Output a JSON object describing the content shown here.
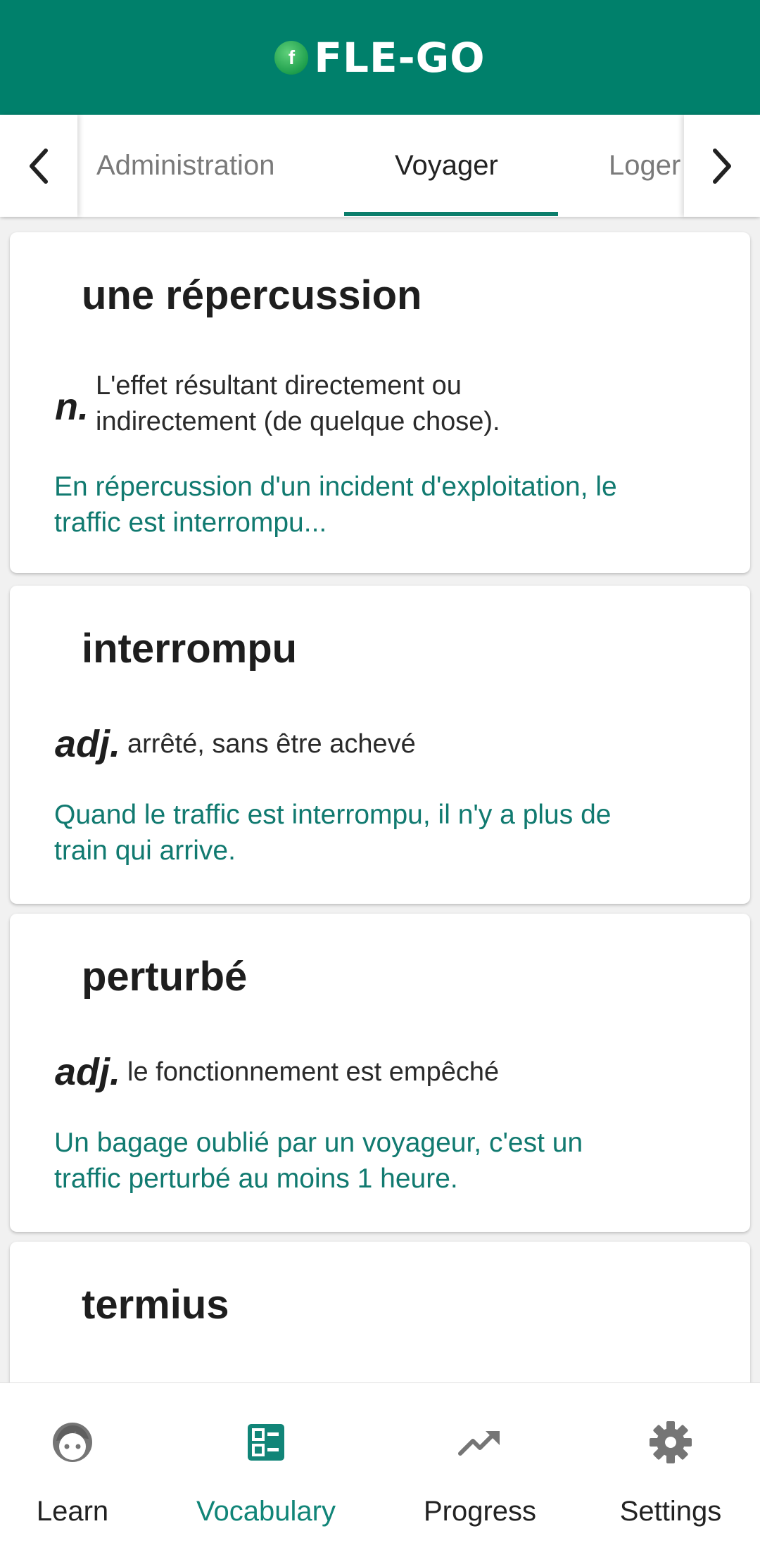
{
  "app": {
    "brand_letter": "f",
    "brand_name": "FLE-GO"
  },
  "tabs": [
    {
      "label": "Administration",
      "active": false
    },
    {
      "label": "Voyager",
      "active": true
    },
    {
      "label": "Loger",
      "active": false
    }
  ],
  "cards": [
    {
      "word": "une répercussion",
      "pos": "n.",
      "definition_lines": [
        "L'effet résultant directement ou",
        "indirectement (de quelque chose)."
      ],
      "example_lines": [
        "En répercussion d'un incident d'exploitation, le",
        "traffic est interrompu..."
      ]
    },
    {
      "word": "interrompu",
      "pos": "adj.",
      "definition_lines": [
        "arrêté, sans être achevé"
      ],
      "example_lines": [
        "Quand le traffic est interrompu, il n'y a plus de",
        "train qui arrive."
      ]
    },
    {
      "word": "perturbé",
      "pos": "adj.",
      "definition_lines": [
        "le fonctionnement est empêché"
      ],
      "example_lines": [
        "Un bagage oublié par un voyageur, c'est un",
        "traffic perturbé au moins 1 heure."
      ]
    },
    {
      "word": "termius"
    }
  ],
  "bottom_nav": [
    {
      "label": "Learn",
      "icon": "face-icon",
      "active": false
    },
    {
      "label": "Vocabulary",
      "icon": "vocabulary-list-icon",
      "active": true
    },
    {
      "label": "Progress",
      "icon": "trending-up-icon",
      "active": false
    },
    {
      "label": "Settings",
      "icon": "gear-icon",
      "active": false
    }
  ],
  "colors": {
    "primary": "#00806b",
    "accent_text": "#117a70",
    "inactive_icon": "#757575"
  }
}
